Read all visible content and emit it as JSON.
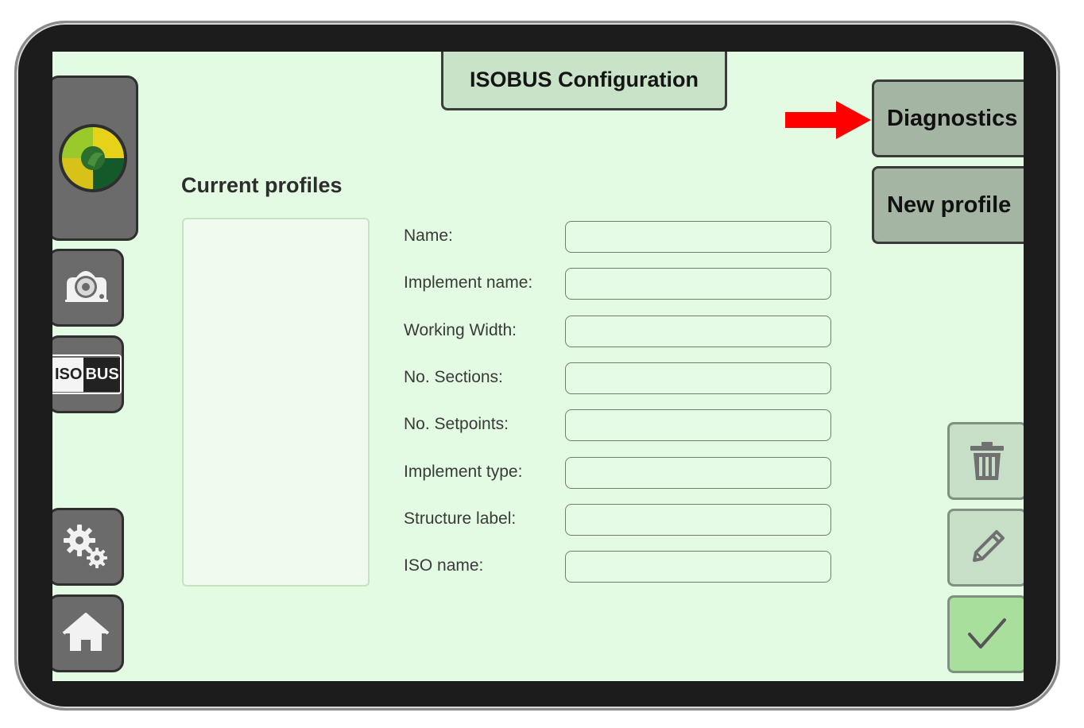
{
  "header": {
    "title": "ISOBUS Configuration"
  },
  "actions": {
    "diagnostics_label": "Diagnostics",
    "new_profile_label": "New profile"
  },
  "profiles": {
    "title": "Current profiles",
    "items": []
  },
  "form": {
    "fields": [
      {
        "label": "Name:",
        "value": ""
      },
      {
        "label": "Implement name:",
        "value": ""
      },
      {
        "label": "Working Width:",
        "value": ""
      },
      {
        "label": "No. Sections:",
        "value": ""
      },
      {
        "label": "No. Setpoints:",
        "value": ""
      },
      {
        "label": "Implement type:",
        "value": ""
      },
      {
        "label": "Structure label:",
        "value": ""
      },
      {
        "label": "ISO name:",
        "value": ""
      }
    ]
  },
  "rail": {
    "iso_logo_left": "ISO",
    "iso_logo_right": "BUS",
    "icons": [
      "app-logo-icon",
      "camera-icon",
      "isobus-icon",
      "settings-gears-icon",
      "home-icon"
    ]
  },
  "toolbar_icons": [
    "trash-icon",
    "pencil-icon",
    "checkmark-icon"
  ],
  "colors": {
    "screen_bg": "#e2fbe2",
    "rail_button": "#6b6b6b",
    "side_button": "#a4b5a4",
    "confirm_button": "#a8df9d",
    "arrow": "#ff0000"
  }
}
